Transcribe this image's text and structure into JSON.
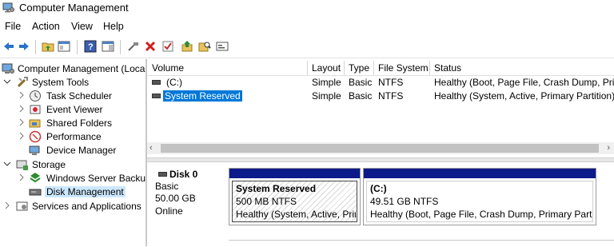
{
  "window": {
    "title": "Computer Management"
  },
  "menu": [
    "File",
    "Action",
    "View",
    "Help"
  ],
  "toolbar": [
    "back-icon",
    "forward-icon",
    "up-folder-icon",
    "show-hide-tree-icon",
    "help-icon",
    "properties-pane-icon",
    "connect-icon",
    "delete-icon",
    "check-icon",
    "folder-up-icon",
    "search-folder-icon",
    "console-icon"
  ],
  "tree": {
    "root": "Computer Management (Local",
    "system_tools": "System Tools",
    "task_scheduler": "Task Scheduler",
    "event_viewer": "Event Viewer",
    "shared_folders": "Shared Folders",
    "performance": "Performance",
    "device_manager": "Device Manager",
    "storage": "Storage",
    "wsb": "Windows Server Backup",
    "disk_management": "Disk Management",
    "services": "Services and Applications"
  },
  "columns": [
    "Volume",
    "Layout",
    "Type",
    "File System",
    "Status"
  ],
  "volumes": [
    {
      "volume": "(C:)",
      "layout": "Simple",
      "type": "Basic",
      "fs": "NTFS",
      "status": "Healthy (Boot, Page File, Crash Dump, Prim"
    },
    {
      "volume": "System Reserved",
      "layout": "Simple",
      "type": "Basic",
      "fs": "NTFS",
      "status": "Healthy (System, Active, Primary Partition)"
    }
  ],
  "disk": {
    "name": "Disk 0",
    "kind": "Basic",
    "size": "50.00 GB",
    "state": "Online"
  },
  "partitions": [
    {
      "name": "System Reserved",
      "size": "500 MB NTFS",
      "status": "Healthy (System, Active, Prim"
    },
    {
      "name": "(C:)",
      "size": "49.51 GB NTFS",
      "status": "Healthy (Boot, Page File, Crash Dump, Primary Partitio"
    }
  ],
  "colors": {
    "partition_bar": "#0c1a8a",
    "selection": "#0078d7",
    "tree_selection": "#cce8ff"
  }
}
